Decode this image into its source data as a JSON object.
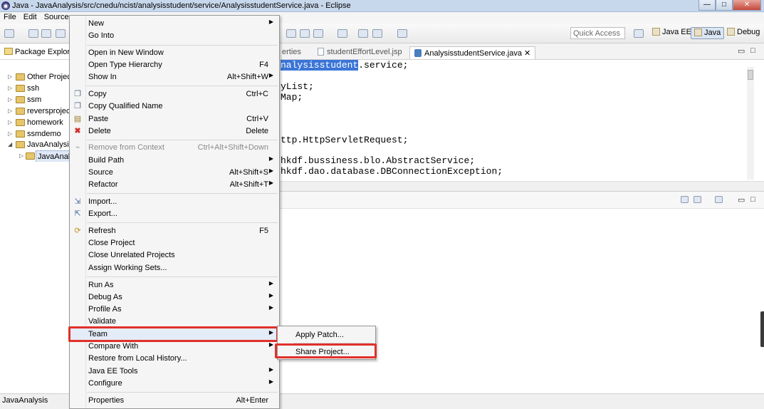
{
  "window": {
    "title": "Java - JavaAnalysis/src/cnedu/ncist/analysisstudent/service/AnalysisstudentService.java - Eclipse",
    "minimize": "—",
    "maximize": "□",
    "close": "✕"
  },
  "menubar": [
    "File",
    "Edit",
    "Source"
  ],
  "toolbar": {
    "quick_access": "Quick Access",
    "perspectives": [
      {
        "label": "Java EE",
        "active": false
      },
      {
        "label": "Java",
        "active": true
      },
      {
        "label": "Debug",
        "active": false
      }
    ]
  },
  "package_explorer": {
    "tab": "Package Explore",
    "items": [
      {
        "label": "Other Project",
        "expanded": false
      },
      {
        "label": "ssh",
        "expanded": false
      },
      {
        "label": "ssm",
        "expanded": false
      },
      {
        "label": "reversproject",
        "expanded": false
      },
      {
        "label": "homework",
        "expanded": false
      },
      {
        "label": "ssmdemo",
        "expanded": false
      },
      {
        "label": "JavaAnalysis",
        "expanded": true
      },
      {
        "label": "JavaAnaly",
        "expanded": false,
        "selected": true
      }
    ]
  },
  "editor": {
    "tabs": [
      {
        "label": "erties",
        "active": false
      },
      {
        "label": "studentEffortLevel.jsp",
        "active": false
      },
      {
        "label": "AnalysisstudentService.java",
        "active": true
      }
    ],
    "lines": [
      {
        "pre": "",
        "hl": "nalysisstudent",
        "post": ".service;"
      },
      {
        "pre": "yList;",
        "hl": "",
        "post": ""
      },
      {
        "pre": "Map;",
        "hl": "",
        "post": ""
      },
      {
        "pre": "ttp.HttpServletRequest;",
        "hl": "",
        "post": ""
      },
      {
        "pre": "hkdf.bussiness.blo.AbstractService;",
        "hl": "",
        "post": ""
      },
      {
        "pre": "hkdf.dao.database.DBConnectionException;",
        "hl": "",
        "post": ""
      }
    ]
  },
  "status": {
    "text": "JavaAnalysis"
  },
  "context_menu": {
    "items": [
      {
        "label": "New",
        "submenu": true
      },
      {
        "label": "Go Into"
      },
      {
        "label": "Open in New Window"
      },
      {
        "label": "Open Type Hierarchy",
        "shortcut": "F4"
      },
      {
        "label": "Show In",
        "shortcut": "Alt+Shift+W",
        "submenu": true
      },
      {
        "label": "Copy",
        "shortcut": "Ctrl+C",
        "icon": "copy-icon"
      },
      {
        "label": "Copy Qualified Name",
        "icon": "copy-qualified-icon"
      },
      {
        "label": "Paste",
        "shortcut": "Ctrl+V",
        "icon": "paste-icon"
      },
      {
        "label": "Delete",
        "shortcut": "Delete",
        "icon": "delete-icon"
      },
      {
        "label": "Remove from Context",
        "shortcut": "Ctrl+Alt+Shift+Down",
        "disabled": true,
        "icon": "remove-context-icon"
      },
      {
        "label": "Build Path",
        "submenu": true
      },
      {
        "label": "Source",
        "shortcut": "Alt+Shift+S",
        "submenu": true
      },
      {
        "label": "Refactor",
        "shortcut": "Alt+Shift+T",
        "submenu": true
      },
      {
        "label": "Import...",
        "icon": "import-icon"
      },
      {
        "label": "Export...",
        "icon": "export-icon"
      },
      {
        "label": "Refresh",
        "shortcut": "F5",
        "icon": "refresh-icon"
      },
      {
        "label": "Close Project"
      },
      {
        "label": "Close Unrelated Projects"
      },
      {
        "label": "Assign Working Sets..."
      },
      {
        "label": "Run As",
        "submenu": true
      },
      {
        "label": "Debug As",
        "submenu": true
      },
      {
        "label": "Profile As",
        "submenu": true
      },
      {
        "label": "Validate"
      },
      {
        "label": "Team",
        "submenu": true,
        "highlighted": true
      },
      {
        "label": "Compare With",
        "submenu": true
      },
      {
        "label": "Restore from Local History..."
      },
      {
        "label": "Java EE Tools",
        "submenu": true
      },
      {
        "label": "Configure",
        "submenu": true
      },
      {
        "label": "Properties",
        "shortcut": "Alt+Enter"
      }
    ]
  },
  "team_submenu": {
    "items": [
      {
        "label": "Apply Patch..."
      },
      {
        "label": "Share Project...",
        "highlighted": true
      }
    ]
  },
  "colors": {
    "highlight_border": "#e0312a",
    "selection_blue": "#3b75d7"
  }
}
